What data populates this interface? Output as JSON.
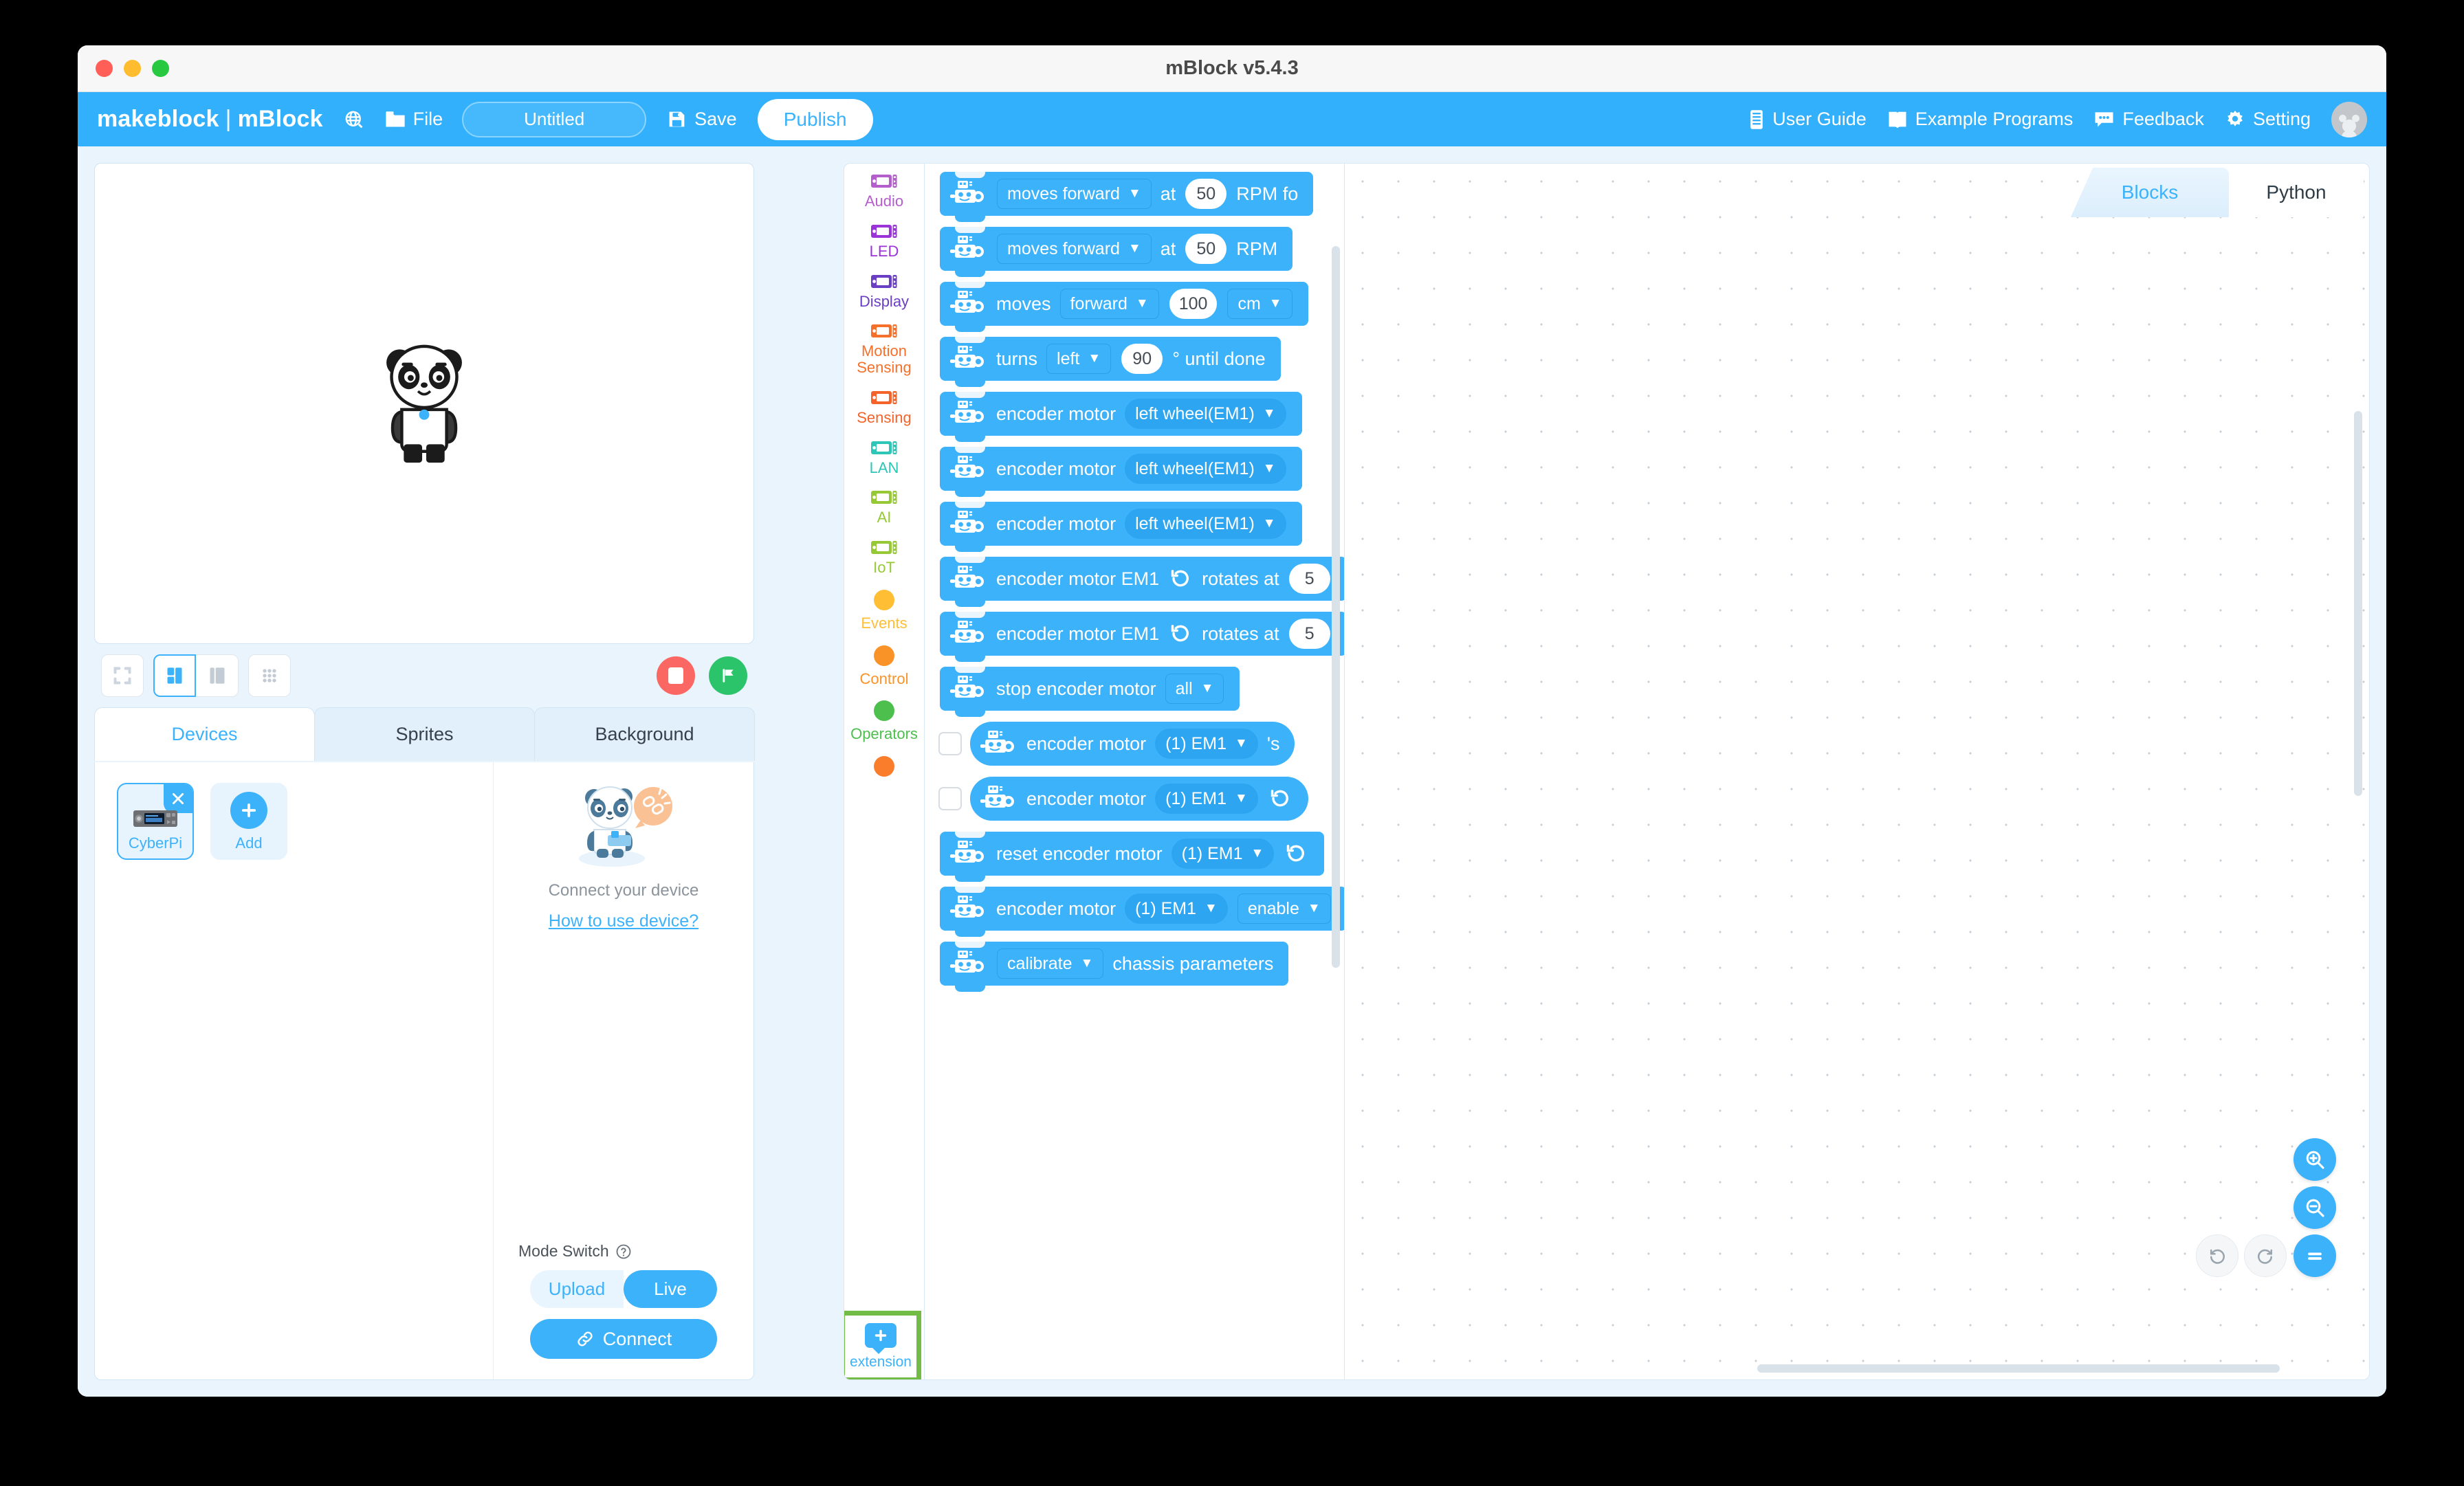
{
  "window": {
    "title": "mBlock v5.4.3"
  },
  "toolbar": {
    "brand_left": "makeblock",
    "brand_sep": "|",
    "brand_right": "mBlock",
    "globe_label": "",
    "file_label": "File",
    "file_name": "Untitled",
    "file_name_placeholder": "Untitled",
    "save_label": "Save",
    "publish_label": "Publish",
    "right_items": [
      {
        "label": "User Guide",
        "icon": "document-icon"
      },
      {
        "label": "Example Programs",
        "icon": "book-icon"
      },
      {
        "label": "Feedback",
        "icon": "chat-icon"
      },
      {
        "label": "Setting",
        "icon": "gear-icon"
      }
    ]
  },
  "stage": {
    "sprite_name": "panda-sprite",
    "layout_buttons": [
      "fullscreen-layout",
      "small-stage-layout",
      "large-stage-layout",
      "grid-layout"
    ],
    "active_layout_index": 1,
    "stop_label": "stop-icon",
    "flag_label": "green-flag-icon"
  },
  "panel": {
    "tabs": [
      {
        "label": "Devices",
        "active": true
      },
      {
        "label": "Sprites",
        "active": false
      },
      {
        "label": "Background",
        "active": false
      }
    ],
    "devices": [
      {
        "label": "CyberPi",
        "selected": true
      },
      {
        "label": "Add",
        "selected": false
      }
    ],
    "connect_hint": "Connect your device",
    "how_to_link": "How to use device?",
    "mode_switch_label": "Mode Switch",
    "mode_options": [
      {
        "label": "Upload",
        "active": false
      },
      {
        "label": "Live",
        "active": true
      }
    ],
    "connect_button": "Connect"
  },
  "categories": [
    {
      "label": "Audio",
      "icon": "board-icon",
      "color": "#b45ecb",
      "type": "board"
    },
    {
      "label": "LED",
      "icon": "board-icon",
      "color": "#9a34d8",
      "type": "board"
    },
    {
      "label": "Display",
      "icon": "board-icon",
      "color": "#6b3fc4",
      "type": "board"
    },
    {
      "label": "Motion Sensing",
      "icon": "board-icon",
      "color": "#f5702a",
      "type": "board"
    },
    {
      "label": "Sensing",
      "icon": "board-icon",
      "color": "#f4642a",
      "type": "board"
    },
    {
      "label": "LAN",
      "icon": "board-icon",
      "color": "#2ec6b6",
      "type": "board"
    },
    {
      "label": "AI",
      "icon": "board-icon",
      "color": "#96c935",
      "type": "board"
    },
    {
      "label": "IoT",
      "icon": "board-icon",
      "color": "#96c935",
      "type": "board"
    },
    {
      "label": "Events",
      "icon": "circle-icon",
      "color": "#ffbe33",
      "type": "circle"
    },
    {
      "label": "Control",
      "icon": "circle-icon",
      "color": "#fa9327",
      "type": "circle"
    },
    {
      "label": "Operators",
      "icon": "circle-icon",
      "color": "#4cbf4c",
      "type": "circle"
    },
    {
      "label": "",
      "icon": "circle-icon",
      "color": "#fa7d2b",
      "type": "circle"
    }
  ],
  "extension": {
    "label": "extension",
    "highlighted": true,
    "highlight_color": "#72bb44"
  },
  "blocks": [
    {
      "kind": "stack",
      "checkbox": false,
      "parts": [
        {
          "t": "field",
          "v": "moves forward",
          "shape": "square"
        },
        {
          "t": "text",
          "v": "at"
        },
        {
          "t": "num",
          "v": "50"
        },
        {
          "t": "text",
          "v": "RPM fo"
        }
      ]
    },
    {
      "kind": "stack",
      "checkbox": false,
      "parts": [
        {
          "t": "field",
          "v": "moves forward",
          "shape": "square"
        },
        {
          "t": "text",
          "v": "at"
        },
        {
          "t": "num",
          "v": "50"
        },
        {
          "t": "text",
          "v": "RPM"
        }
      ]
    },
    {
      "kind": "stack",
      "checkbox": false,
      "parts": [
        {
          "t": "text",
          "v": "moves"
        },
        {
          "t": "field",
          "v": "forward",
          "shape": "square"
        },
        {
          "t": "num",
          "v": "100"
        },
        {
          "t": "field",
          "v": "cm",
          "shape": "square"
        }
      ]
    },
    {
      "kind": "stack",
      "checkbox": false,
      "parts": [
        {
          "t": "text",
          "v": "turns"
        },
        {
          "t": "field",
          "v": "left",
          "shape": "square"
        },
        {
          "t": "num",
          "v": "90"
        },
        {
          "t": "text",
          "v": "° until done"
        }
      ]
    },
    {
      "kind": "stack",
      "checkbox": false,
      "parts": [
        {
          "t": "text",
          "v": "encoder motor"
        },
        {
          "t": "field",
          "v": "left wheel(EM1)",
          "shape": "round"
        }
      ]
    },
    {
      "kind": "stack",
      "checkbox": false,
      "parts": [
        {
          "t": "text",
          "v": "encoder motor"
        },
        {
          "t": "field",
          "v": "left wheel(EM1)",
          "shape": "round"
        }
      ]
    },
    {
      "kind": "stack",
      "checkbox": false,
      "parts": [
        {
          "t": "text",
          "v": "encoder motor"
        },
        {
          "t": "field",
          "v": "left wheel(EM1)",
          "shape": "round"
        }
      ]
    },
    {
      "kind": "stack",
      "checkbox": false,
      "parts": [
        {
          "t": "text",
          "v": "encoder motor EM1"
        },
        {
          "t": "rot"
        },
        {
          "t": "text",
          "v": "rotates at"
        },
        {
          "t": "num",
          "v": "5"
        }
      ]
    },
    {
      "kind": "stack",
      "checkbox": false,
      "parts": [
        {
          "t": "text",
          "v": "encoder motor EM1"
        },
        {
          "t": "rot"
        },
        {
          "t": "text",
          "v": "rotates at"
        },
        {
          "t": "num",
          "v": "5"
        }
      ]
    },
    {
      "kind": "stack",
      "checkbox": false,
      "parts": [
        {
          "t": "text",
          "v": "stop encoder motor"
        },
        {
          "t": "field",
          "v": "all",
          "shape": "square"
        }
      ]
    },
    {
      "kind": "reporter",
      "checkbox": true,
      "parts": [
        {
          "t": "text",
          "v": "encoder motor"
        },
        {
          "t": "field",
          "v": "(1) EM1",
          "shape": "round"
        },
        {
          "t": "text",
          "v": "'s"
        }
      ]
    },
    {
      "kind": "reporter",
      "checkbox": true,
      "parts": [
        {
          "t": "text",
          "v": "encoder motor"
        },
        {
          "t": "field",
          "v": "(1) EM1",
          "shape": "round"
        },
        {
          "t": "rot"
        }
      ]
    },
    {
      "kind": "stack",
      "checkbox": false,
      "parts": [
        {
          "t": "text",
          "v": "reset encoder motor"
        },
        {
          "t": "field",
          "v": "(1) EM1",
          "shape": "round"
        },
        {
          "t": "rot"
        }
      ]
    },
    {
      "kind": "stack",
      "checkbox": false,
      "parts": [
        {
          "t": "text",
          "v": "encoder motor"
        },
        {
          "t": "field",
          "v": "(1) EM1",
          "shape": "round"
        },
        {
          "t": "field",
          "v": "enable",
          "shape": "square"
        }
      ]
    },
    {
      "kind": "stack",
      "checkbox": false,
      "parts": [
        {
          "t": "field",
          "v": "calibrate",
          "shape": "square"
        },
        {
          "t": "text",
          "v": "chassis parameters"
        }
      ]
    }
  ],
  "editor": {
    "tabs": [
      {
        "label": "Blocks",
        "active": true
      },
      {
        "label": "Python",
        "active": false
      }
    ],
    "zoom_in": "zoom-in-icon",
    "zoom_out": "zoom-out-icon",
    "zoom_reset": "zoom-reset-icon",
    "undo": "undo-icon",
    "redo": "redo-icon"
  },
  "colors": {
    "accent": "#3cb2fb",
    "toolbar": "#32b0fc",
    "body_bg": "#eaf4fd",
    "highlight_green": "#72bb44",
    "stop_red": "#fb6863",
    "flag_green": "#2bc46b"
  }
}
